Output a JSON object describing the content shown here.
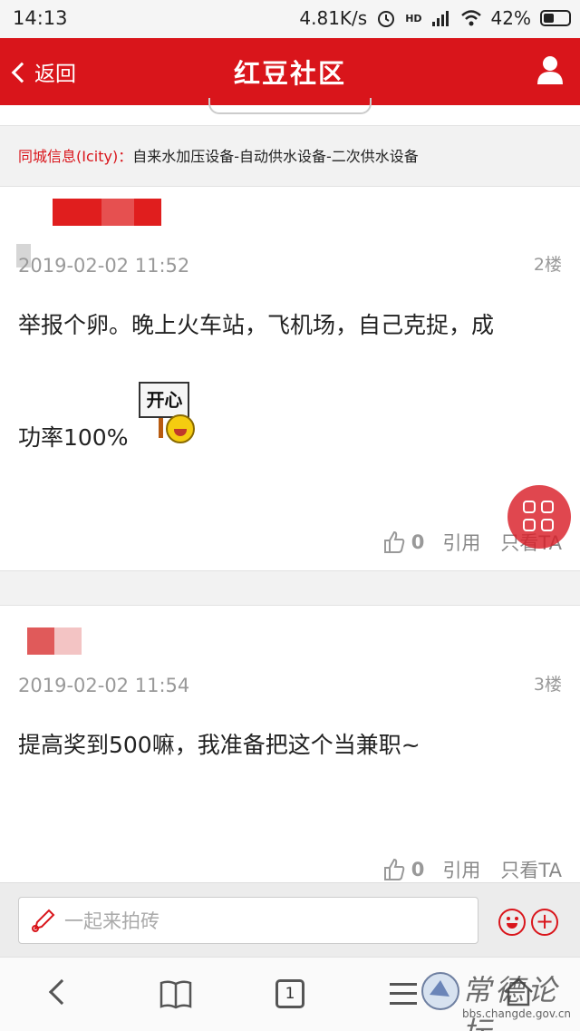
{
  "status_bar": {
    "time": "14:13",
    "speed": "4.81K/s",
    "network": "HD",
    "battery": "42%"
  },
  "nav": {
    "back_label": "返回",
    "title": "红豆社区"
  },
  "city_info": {
    "label": "同城信息(Icity)：",
    "link": "自来水加压设备-自动供水设备-二次供水设备"
  },
  "posts": [
    {
      "date": "2019-02-02 11:52",
      "floor": "2楼",
      "content_line1": "举报个卵。晚上火车站，飞机场，自己克捉，成",
      "content_line2": "功率100%",
      "sticker_text": "开心",
      "likes": "0",
      "cite_label": "引用",
      "only_label": "只看TA"
    },
    {
      "date": "2019-02-02 11:54",
      "floor": "3楼",
      "content_line1": "提高奖到500嘛，我准备把这个当兼职~",
      "likes": "0",
      "cite_label": "引用",
      "only_label": "只看TA"
    }
  ],
  "reply": {
    "placeholder": "一起来拍砖"
  },
  "browser": {
    "tab_count": "1"
  },
  "watermark": {
    "logo": "常德论坛",
    "domain": "bbs.changde.gov.cn"
  },
  "colors": {
    "brand_red": "#d9151b",
    "background_gray": "#f2f2f2"
  }
}
